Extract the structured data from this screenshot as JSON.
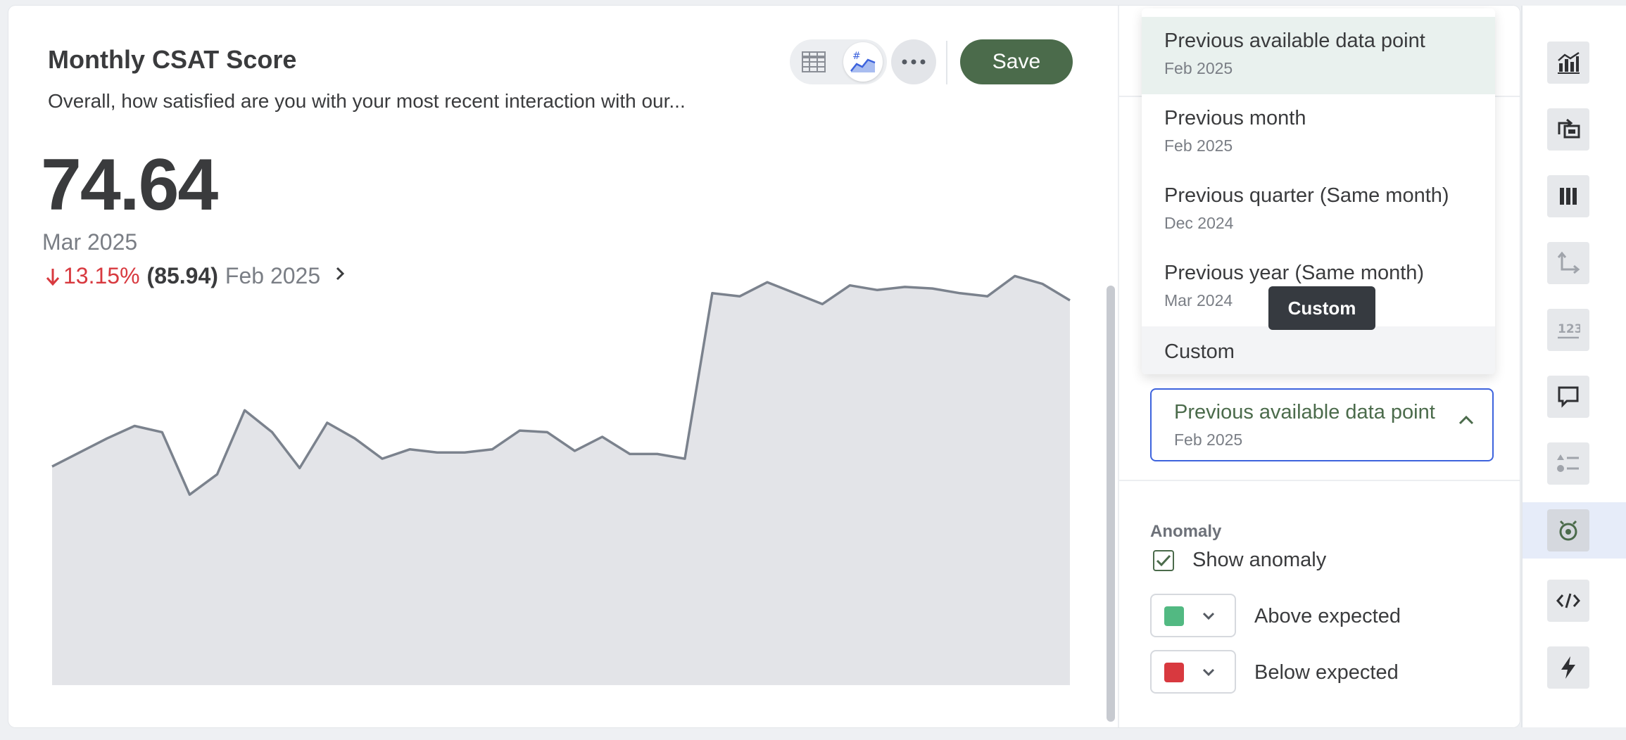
{
  "card": {
    "title": "Monthly CSAT Score",
    "subtitle": "Overall, how satisfied are you with your most recent interaction with our...",
    "metric_value": "74.64",
    "metric_period": "Mar 2025",
    "comparison": {
      "change_pct": "13.15%",
      "direction": "down",
      "previous_value": "(85.94)",
      "previous_label": "Feb 2025"
    },
    "toolbar": {
      "table_view_icon": "table-icon",
      "chart_view_icon": "trend-chart-icon",
      "more_icon": "ellipsis-icon",
      "save_label": "Save"
    }
  },
  "chart_data": {
    "type": "area",
    "x": [
      1,
      2,
      3,
      4,
      5,
      6,
      7,
      8,
      9,
      10,
      11,
      12,
      13,
      14,
      15,
      16,
      17,
      18,
      19,
      20,
      21,
      22,
      23,
      24,
      25,
      26,
      27,
      28,
      29,
      30,
      31,
      32,
      33,
      34,
      35,
      36,
      37,
      38
    ],
    "series": [
      {
        "values": [
          64.0,
          64.9,
          65.8,
          66.6,
          66.2,
          62.2,
          63.5,
          67.6,
          66.2,
          63.9,
          66.8,
          65.8,
          64.5,
          65.1,
          64.9,
          64.9,
          65.1,
          66.3,
          66.2,
          65.0,
          65.9,
          64.8,
          64.8,
          64.5,
          75.1,
          74.9,
          75.8,
          75.1,
          74.4,
          75.6,
          75.3,
          75.5,
          75.4,
          75.1,
          74.9,
          76.2,
          75.7,
          74.64
        ]
      }
    ],
    "color": "#7b828d",
    "fill": "#e3e4e8",
    "grid": false
  },
  "settings": {
    "comparison_options": [
      {
        "label": "Previous available data point",
        "sub": "Feb 2025",
        "selected": true
      },
      {
        "label": "Previous month",
        "sub": "Feb 2025"
      },
      {
        "label": "Previous quarter (Same month)",
        "sub": "Dec 2024"
      },
      {
        "label": "Previous year (Same month)",
        "sub": "Mar 2024"
      },
      {
        "label": "Custom"
      }
    ],
    "tooltip": "Custom",
    "selected": {
      "label": "Previous available data point",
      "sub": "Feb 2025"
    },
    "anomaly": {
      "title": "Anomaly",
      "show_label": "Show anomaly",
      "show_checked": true,
      "above_label": "Above expected",
      "above_color": "#52b982",
      "below_label": "Below expected",
      "below_color": "#d8393f"
    }
  },
  "rail": {
    "icons": [
      "chart-type-icon",
      "swap-data-icon",
      "columns-icon",
      "axis-icon",
      "number-format-icon",
      "comment-icon",
      "legend-icon",
      "goal-icon",
      "code-icon",
      "lightning-icon"
    ],
    "active": "goal-icon"
  }
}
